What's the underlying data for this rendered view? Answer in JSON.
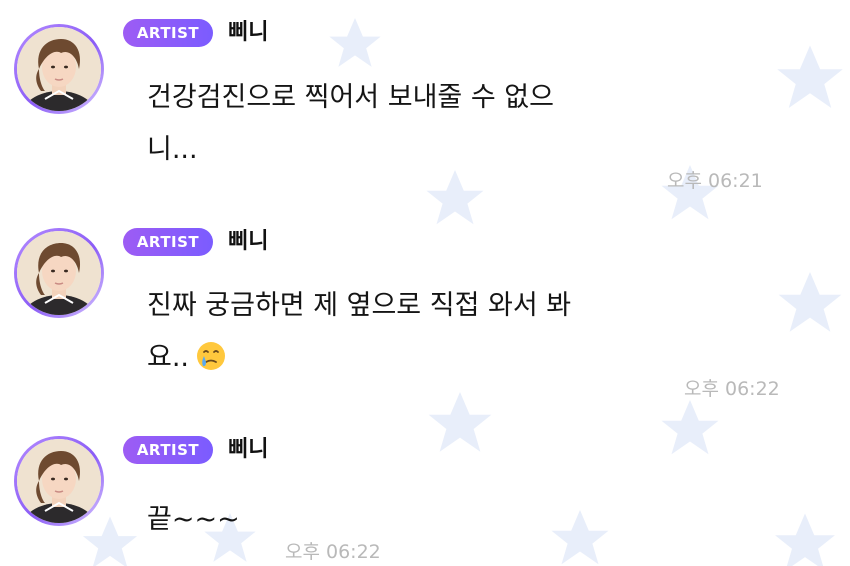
{
  "theme": {
    "badge_gradient_start": "#9d5cf4",
    "badge_gradient_end": "#7b5cff",
    "avatar_ring": "#8b5cf6",
    "star_color": "#e7eefb",
    "time_color": "#b9b9b9"
  },
  "messages": [
    {
      "badge": "ARTIST",
      "sender": "삐니",
      "text": "건강검진으로 찍어서 보내줄 수 없으\n니...",
      "time": "오후 06:21"
    },
    {
      "badge": "ARTIST",
      "sender": "삐니",
      "text": "진짜 궁금하면 제 옆으로 직접 와서 봐\n요..",
      "emoji": "crying-face-emoji",
      "time": "오후 06:22"
    },
    {
      "badge": "ARTIST",
      "sender": "삐니",
      "text": "끝~~~",
      "time": "오후 06:22"
    }
  ]
}
